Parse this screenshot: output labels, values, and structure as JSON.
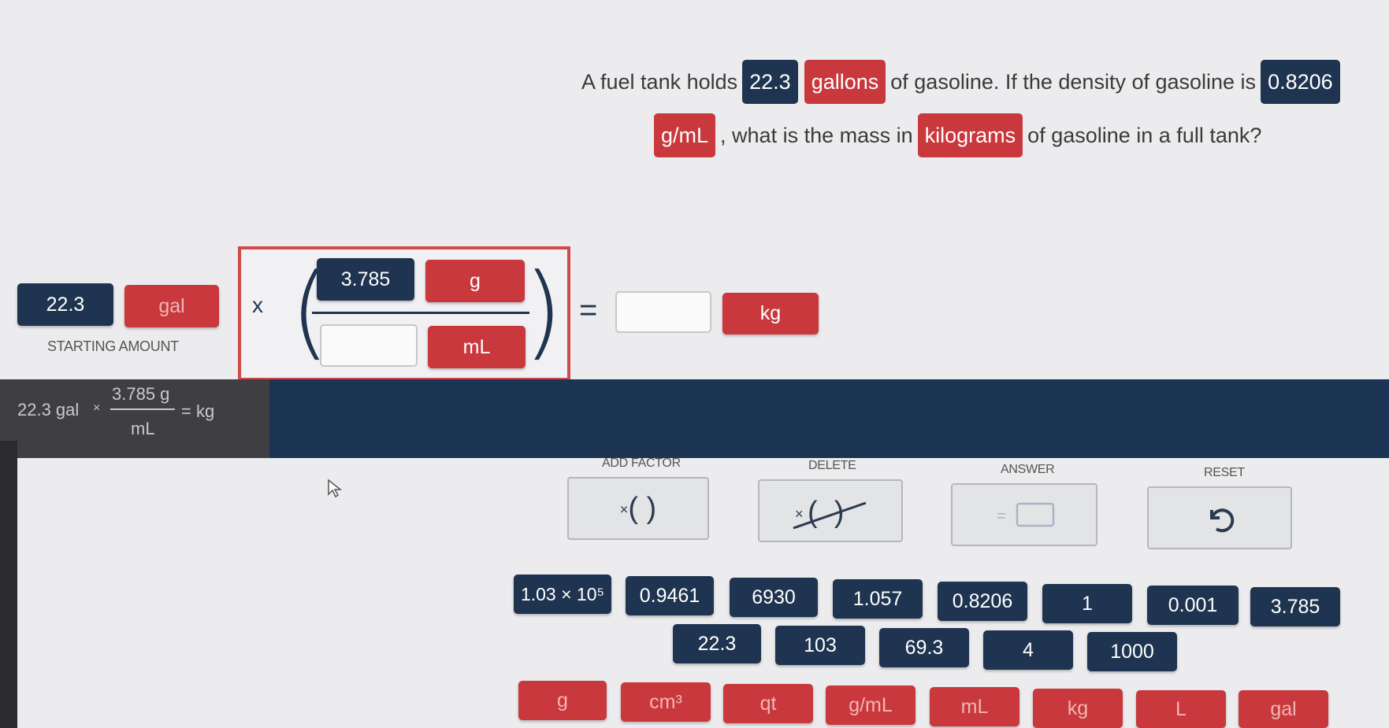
{
  "question": {
    "line1": {
      "t1": "A fuel tank holds",
      "amount": "22.3",
      "unit": "gallons",
      "t2": "of gasoline. If the density of gasoline is",
      "density": "0.8206"
    },
    "line2": {
      "density_unit": "g/mL",
      "t3": ", what is the mass in",
      "target_unit": "kilograms",
      "t4": "of gasoline in a full tank?"
    }
  },
  "starting": {
    "value": "22.3",
    "unit": "gal",
    "label": "STARTING AMOUNT"
  },
  "factor": {
    "multiply": "x",
    "numerator_value": "3.785",
    "numerator_unit": "g",
    "denominator_value": "",
    "denominator_unit": "mL",
    "equals": "=",
    "answer_value": "",
    "answer_unit": "kg"
  },
  "summary": {
    "start": "22.3 gal",
    "times": "×",
    "num": "3.785 g",
    "den": "mL",
    "eq": "= kg"
  },
  "actions": [
    {
      "label": "ADD FACTOR",
      "icon": "add-factor-icon",
      "glyph": "×( )"
    },
    {
      "label": "DELETE",
      "icon": "delete-factor-icon",
      "glyph": "×( )"
    },
    {
      "label": "ANSWER",
      "icon": "answer-icon",
      "glyph": "="
    },
    {
      "label": "RESET",
      "icon": "reset-icon",
      "glyph": "↺"
    }
  ],
  "number_tiles_row1": [
    "1.03 × 10⁵",
    "0.9461",
    "6930",
    "1.057",
    "0.8206",
    "1",
    "0.001",
    "3.785"
  ],
  "number_tiles_row2": [
    "22.3",
    "103",
    "69.3",
    "4",
    "1000"
  ],
  "unit_tiles": [
    "g",
    "cm³",
    "qt",
    "g/mL",
    "mL",
    "kg",
    "L",
    "gal"
  ],
  "colors": {
    "navy": "#1f3450",
    "red": "#c9383c",
    "band": "#1d3554"
  }
}
